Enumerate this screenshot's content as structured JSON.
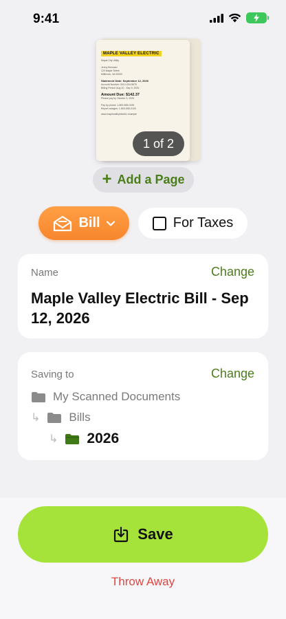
{
  "status_bar": {
    "time": "9:41"
  },
  "document": {
    "brand": "MAPLE VALLEY ELECTRIC",
    "lines": [
      "Maple City Utility",
      "",
      "Jenny Brennan",
      "123 Maple Street",
      "Millbrook, VA 00000"
    ],
    "statement": "Statement Date: September 12, 2026",
    "account": "Account Number: 0012-034-5678",
    "billing": "Billing Period: Aug 10 - Sep 9, 2026",
    "amount": "Amount Due: $142.37",
    "due": "Please pay by October 3, 2026",
    "footer1": "Pay by phone: 1-800-555-0199",
    "footer2": "Report outages: 1-800-555-0100",
    "footer3": "www.maplevalleyelectric.example",
    "page_indicator": "1 of 2"
  },
  "add_page": {
    "label": "Add a Page"
  },
  "doc_type": {
    "label": "Bill"
  },
  "taxes": {
    "label": "For Taxes",
    "checked": false
  },
  "name_card": {
    "label": "Name",
    "change": "Change",
    "value": "Maple Valley Electric Bill - Sep 12, 2026"
  },
  "saving_card": {
    "label": "Saving to",
    "change": "Change",
    "path": [
      "My Scanned Documents",
      "Bills",
      "2026"
    ]
  },
  "actions": {
    "save": "Save",
    "throw_away": "Throw Away"
  },
  "colors": {
    "accent_green": "#4b7d1a",
    "save_green": "#a6e33a",
    "bill_orange": "#f7862d",
    "danger_red": "#e0443f"
  }
}
